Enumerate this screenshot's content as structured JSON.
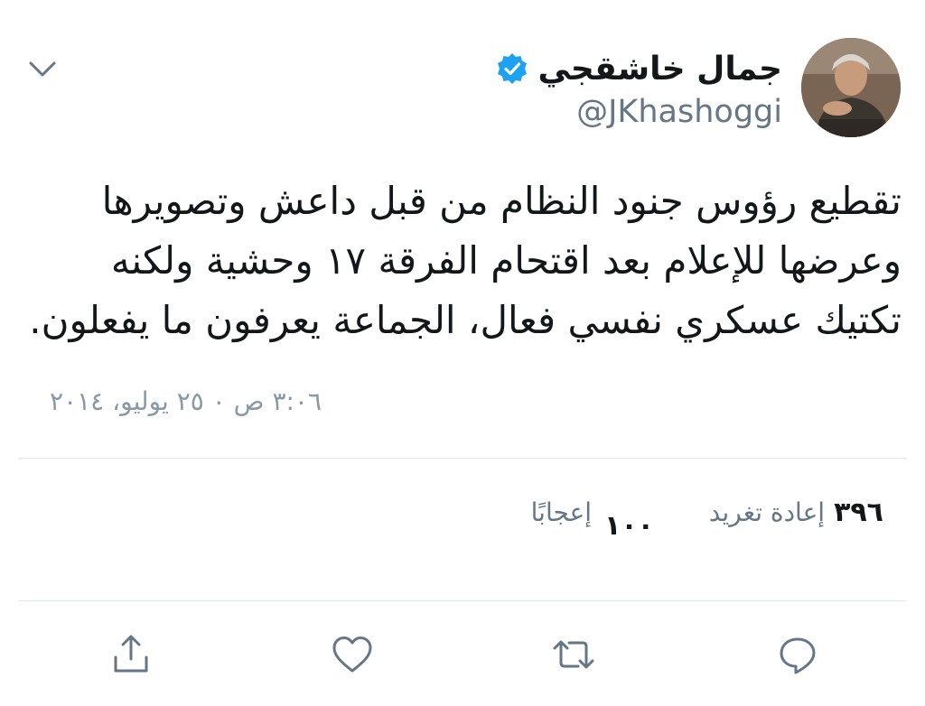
{
  "user": {
    "display_name": "جمال خاشقجي",
    "handle": "@JKhashoggi",
    "verified": true
  },
  "tweet": {
    "text": "تقطيع رؤوس جنود النظام من قبل داعش وتصويرها\nوعرضها للإعلام بعد اقتحام الفرقة ١٧ وحشية ولكنه\nتكتيك عسكري نفسي فعال، الجماعة يعرفون ما يفعلون.",
    "timestamp": "٣:٠٦ ص ٠ ٢٥ يوليو، ٢٠١٤"
  },
  "stats": {
    "retweets_count": "٣٩٦",
    "retweets_label": "إعادة تغريد",
    "likes_count": "١٠٠",
    "likes_label": "إعجابًا"
  },
  "icons": {
    "collapse": "chevron-down-icon",
    "verified": "verified-badge-icon",
    "reply": "reply-icon",
    "retweet": "retweet-icon",
    "like": "heart-icon",
    "share": "share-icon"
  },
  "colors": {
    "verified_blue": "#1da1f2",
    "secondary_text": "#657786",
    "timestamp_text": "#8899a6",
    "divider": "#e1e8ed",
    "icon": "#657786"
  }
}
